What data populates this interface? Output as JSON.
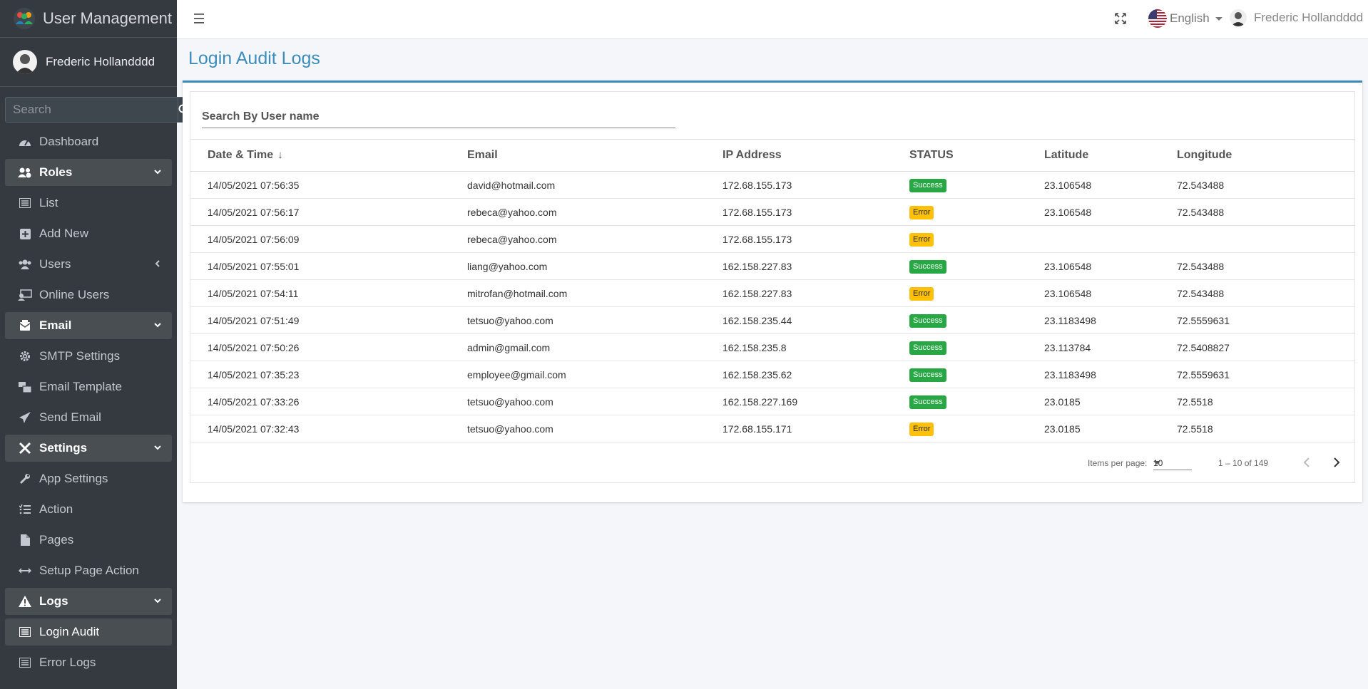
{
  "app": {
    "title": "User Management"
  },
  "sidebar": {
    "user_name": "Frederic Hollandddd",
    "search_placeholder": "Search",
    "items": [
      {
        "label": "Dashboard",
        "icon": "dashboard-icon"
      },
      {
        "label": "Roles",
        "icon": "users-cog-icon"
      },
      {
        "label": "List",
        "icon": "list-icon"
      },
      {
        "label": "Add New",
        "icon": "plus-square-icon"
      },
      {
        "label": "Users",
        "icon": "users-icon"
      },
      {
        "label": "Online Users",
        "icon": "online-users-icon"
      },
      {
        "label": "Email",
        "icon": "envelope-icon"
      },
      {
        "label": "SMTP Settings",
        "icon": "gear-icon"
      },
      {
        "label": "Email Template",
        "icon": "mail-bulk-icon"
      },
      {
        "label": "Send Email",
        "icon": "paper-plane-icon"
      },
      {
        "label": "Settings",
        "icon": "tools-icon"
      },
      {
        "label": "App Settings",
        "icon": "wrench-icon"
      },
      {
        "label": "Action",
        "icon": "tasks-icon"
      },
      {
        "label": "Pages",
        "icon": "file-icon"
      },
      {
        "label": "Setup Page Action",
        "icon": "arrows-h-icon"
      },
      {
        "label": "Logs",
        "icon": "warning-icon"
      },
      {
        "label": "Login Audit",
        "icon": "list-icon"
      },
      {
        "label": "Error Logs",
        "icon": "list-icon"
      }
    ]
  },
  "header": {
    "language": "English",
    "user_name": "Frederic Hollandddd"
  },
  "main": {
    "page_title": "Login Audit Logs",
    "search_placeholder": "Search By User name",
    "columns": [
      "Date & Time",
      "Email",
      "IP Address",
      "STATUS",
      "Latitude",
      "Longitude"
    ],
    "sort_indicator": "↓",
    "rows": [
      {
        "datetime": "14/05/2021 07:56:35",
        "email": "david@hotmail.com",
        "ip": "172.68.155.173",
        "status": "Success",
        "lat": "23.106548",
        "lng": "72.543488"
      },
      {
        "datetime": "14/05/2021 07:56:17",
        "email": "rebeca@yahoo.com",
        "ip": "172.68.155.173",
        "status": "Error",
        "lat": "23.106548",
        "lng": "72.543488"
      },
      {
        "datetime": "14/05/2021 07:56:09",
        "email": "rebeca@yahoo.com",
        "ip": "172.68.155.173",
        "status": "Error",
        "lat": "",
        "lng": ""
      },
      {
        "datetime": "14/05/2021 07:55:01",
        "email": "liang@yahoo.com",
        "ip": "162.158.227.83",
        "status": "Success",
        "lat": "23.106548",
        "lng": "72.543488"
      },
      {
        "datetime": "14/05/2021 07:54:11",
        "email": "mitrofan@hotmail.com",
        "ip": "162.158.227.83",
        "status": "Error",
        "lat": "23.106548",
        "lng": "72.543488"
      },
      {
        "datetime": "14/05/2021 07:51:49",
        "email": "tetsuo@yahoo.com",
        "ip": "162.158.235.44",
        "status": "Success",
        "lat": "23.1183498",
        "lng": "72.5559631"
      },
      {
        "datetime": "14/05/2021 07:50:26",
        "email": "admin@gmail.com",
        "ip": "162.158.235.8",
        "status": "Success",
        "lat": "23.113784",
        "lng": "72.5408827"
      },
      {
        "datetime": "14/05/2021 07:35:23",
        "email": "employee@gmail.com",
        "ip": "162.158.235.62",
        "status": "Success",
        "lat": "23.1183498",
        "lng": "72.5559631"
      },
      {
        "datetime": "14/05/2021 07:33:26",
        "email": "tetsuo@yahoo.com",
        "ip": "162.158.227.169",
        "status": "Success",
        "lat": "23.0185",
        "lng": "72.5518"
      },
      {
        "datetime": "14/05/2021 07:32:43",
        "email": "tetsuo@yahoo.com",
        "ip": "172.68.155.171",
        "status": "Error",
        "lat": "23.0185",
        "lng": "72.5518"
      }
    ],
    "paginator": {
      "items_per_page_label": "Items per page:",
      "items_per_page": "10",
      "range": "1 – 10 of 149"
    }
  },
  "colors": {
    "accent": "#3c8dbc",
    "sidebar_bg": "#343a40",
    "success": "#28a745",
    "error": "#ffc107"
  }
}
